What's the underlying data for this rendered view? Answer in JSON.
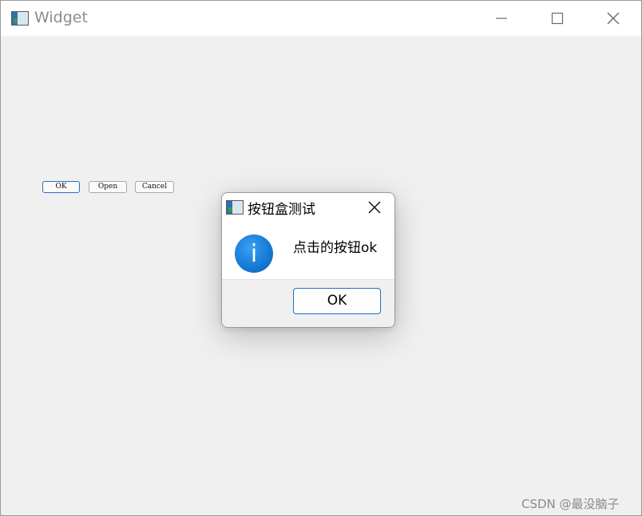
{
  "window": {
    "title": "Widget"
  },
  "main_buttons": [
    {
      "label": "OK"
    },
    {
      "label": "Open"
    },
    {
      "label": "Cancel"
    }
  ],
  "dialog": {
    "title": "按钮盒测试",
    "icon": "info-icon",
    "icon_glyph": "i",
    "message": "点击的按钮ok",
    "ok_label": "OK"
  },
  "watermark": "CSDN @最没脑子",
  "colors": {
    "accent": "#1f6fbf",
    "info_icon": "#1479d3"
  }
}
